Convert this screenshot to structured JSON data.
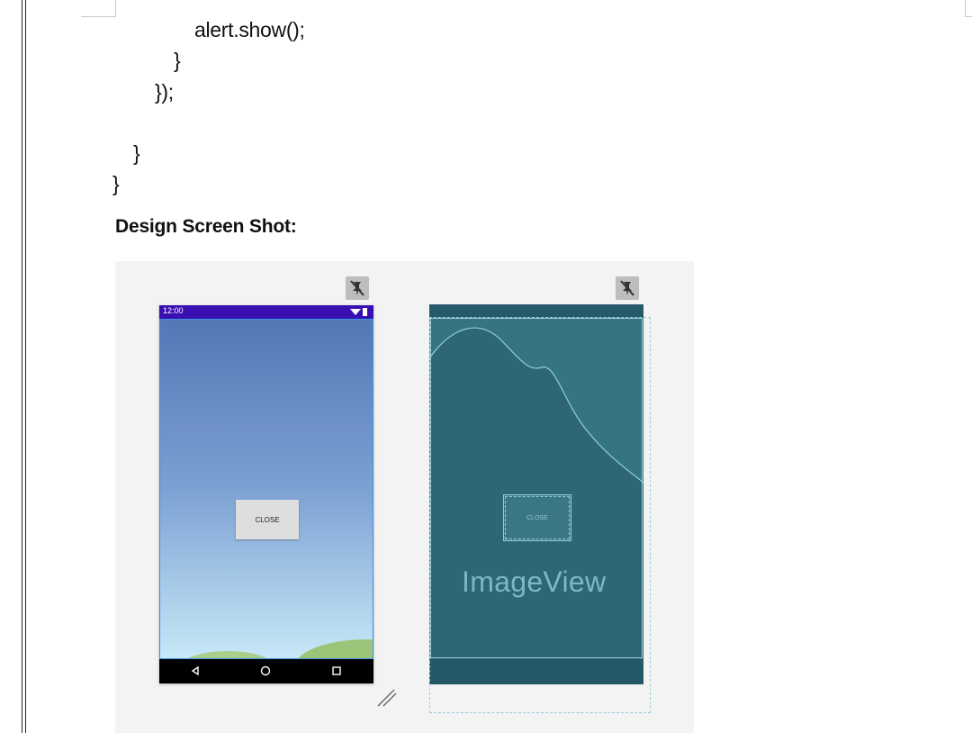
{
  "document": {
    "code_lines": [
      "alert.show();",
      "}",
      "});",
      "}",
      "}"
    ],
    "heading": "Design Screen Shot:"
  },
  "design_preview": {
    "status_time": "12:00",
    "close_button_label": "CLOSE",
    "status_bar_color": "#3a0fb2"
  },
  "blueprint_preview": {
    "close_button_label": "CLOSE",
    "image_view_label": "ImageView",
    "background_color": "#2f6675"
  },
  "icons": {
    "pin_left": "pin-off-icon",
    "pin_right": "pin-off-icon",
    "nav_back": "back-triangle-icon",
    "nav_home": "home-circle-icon",
    "nav_recents": "recents-square-icon",
    "resize": "resize-handle-icon"
  }
}
